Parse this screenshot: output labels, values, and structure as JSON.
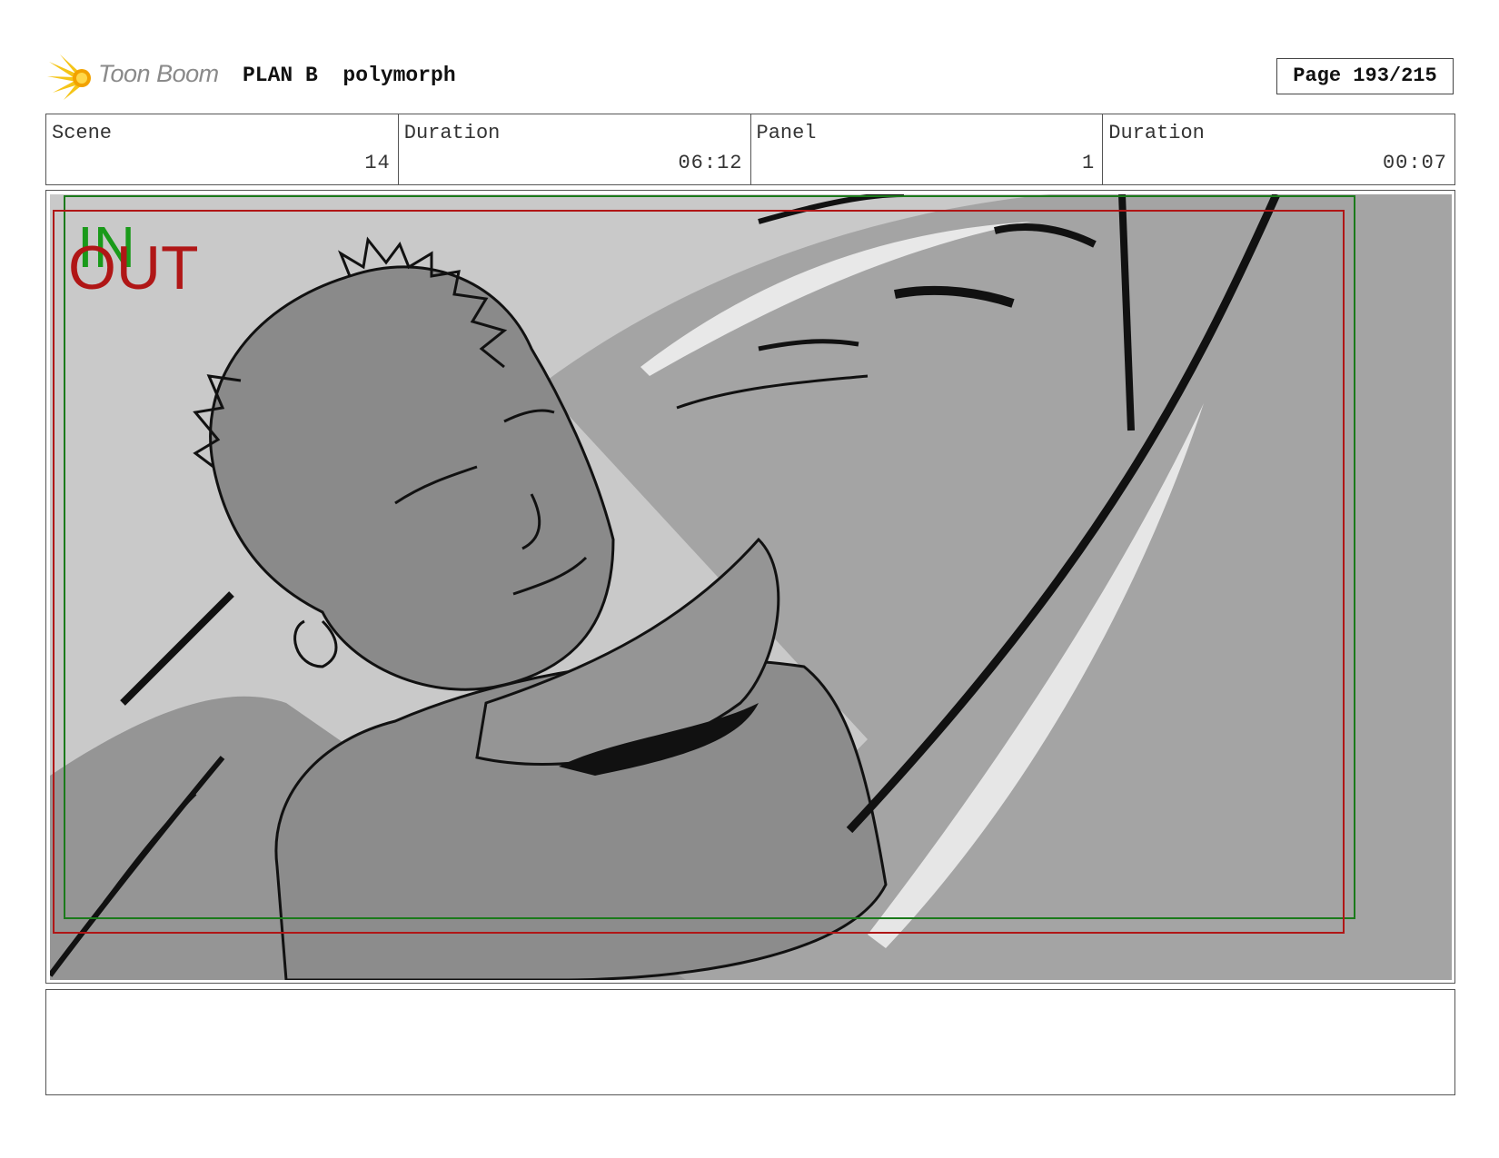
{
  "header": {
    "logo_text": "Toon Boom",
    "project": "PLAN B  polymorph",
    "page": "Page 193/215"
  },
  "info": {
    "scene_label": "Scene",
    "scene_value": "14",
    "scene_duration_label": "Duration",
    "scene_duration_value": "06:12",
    "panel_label": "Panel",
    "panel_value": "1",
    "panel_duration_label": "Duration",
    "panel_duration_value": "00:07"
  },
  "frame": {
    "in_label": "IN",
    "out_label": "OUT",
    "in_color": "#1a9a1a",
    "out_color": "#b01616"
  },
  "notes": {
    "text": ""
  }
}
